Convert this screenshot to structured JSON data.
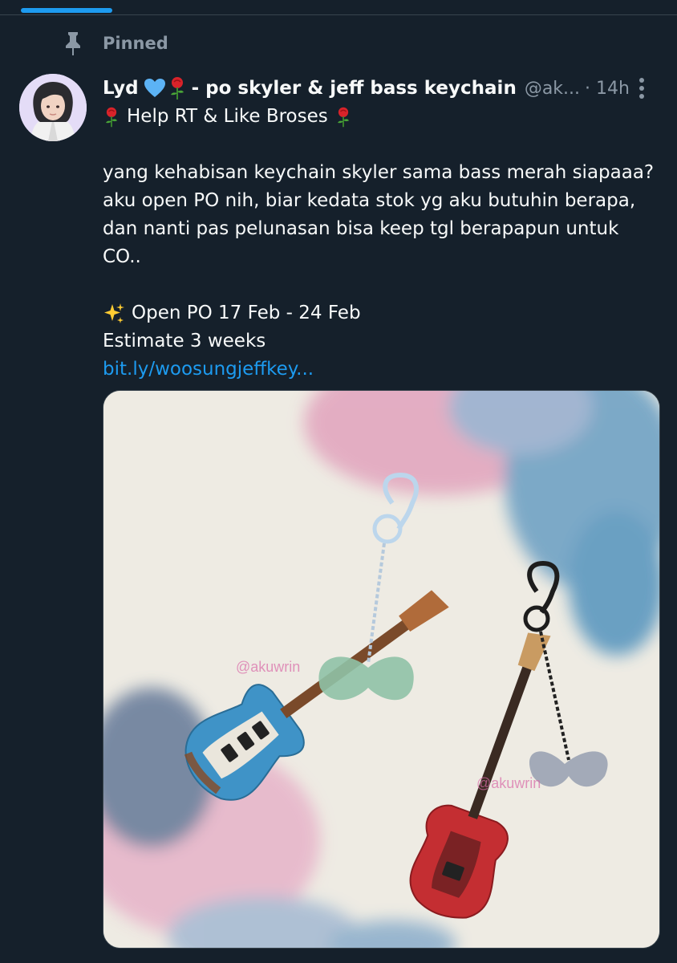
{
  "pinned": {
    "label": "Pinned",
    "icon": "pin-icon"
  },
  "author": {
    "name": "Lyd",
    "name_suffix": "- po skyler & jeff bass keychain",
    "handle": "@ak...",
    "time": "· 14h",
    "avatar_icon": "avatar",
    "emojis": [
      "blue-heart",
      "rose"
    ]
  },
  "tweet": {
    "line1": "Help RT & Like Broses",
    "para1": [
      "yang kehabisan keychain skyler sama bass merah siapaaa?",
      "aku open PO nih, biar kedata stok yg aku butuhin berapa,",
      "dan nanti pas pelunasan bisa keep tgl berapapun untuk",
      "CO.."
    ],
    "open_po": "Open PO 17 Feb - 24 Feb",
    "estimate": "Estimate 3 weeks",
    "link": "bit.ly/woosungjeffkey..."
  },
  "media": {
    "description_icon": "keychain-photo",
    "watermark_1": "@akuwrin",
    "watermark_2": "@akuwrin"
  },
  "colors": {
    "background": "#15202b",
    "text": "#f7f9f9",
    "muted": "#8b98a5",
    "accent": "#1d9bf0",
    "divider": "#38444d"
  }
}
